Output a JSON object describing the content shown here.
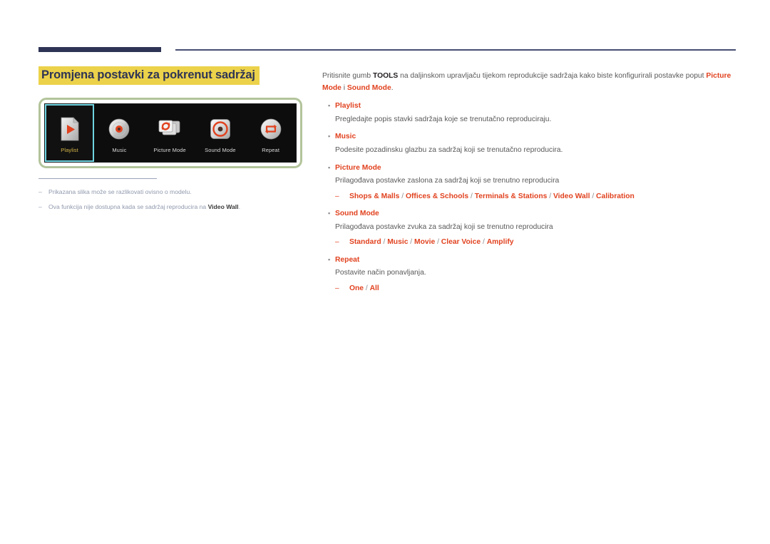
{
  "page": {
    "title": "Promjena postavki za pokrenut sadržaj",
    "accent_color": "#e1421f",
    "title_highlight_color": "#ecd24a",
    "title_text_color": "#2e3455",
    "rule_color": "#2e3455"
  },
  "device": {
    "toolbar": [
      {
        "label": "Playlist",
        "icon": "playlist-page-play-icon",
        "selected": true
      },
      {
        "label": "Music",
        "icon": "music-disc-icon",
        "selected": false
      },
      {
        "label": "Picture Mode",
        "icon": "picture-mode-cards-refresh-icon",
        "selected": false
      },
      {
        "label": "Sound Mode",
        "icon": "sound-mode-dial-icon",
        "selected": false
      },
      {
        "label": "Repeat",
        "icon": "repeat-loop-icon",
        "selected": false
      }
    ]
  },
  "footnotes": {
    "dash": "–",
    "items": [
      {
        "text_before": "Prikazana slika može se razlikovati ovisno o modelu.",
        "bold": "",
        "text_after": ""
      },
      {
        "text_before": "Ova funkcija nije dostupna kada se sadržaj reproducira na ",
        "bold": "Video Wall",
        "text_after": "."
      }
    ]
  },
  "content": {
    "intro": {
      "part1": "Pritisnite gumb ",
      "tools": "TOOLS",
      "part2": " na daljinskom upravljaču tijekom reprodukcije sadržaja kako biste konfigurirali postavke poput ",
      "picture_mode": "Picture Mode",
      "part3": " i ",
      "sound_mode": "Sound Mode",
      "part4": "."
    },
    "bullet_mark": "▪",
    "sub_mark": "–",
    "items": [
      {
        "title": "Playlist",
        "desc": "Pregledajte popis stavki sadržaja koje se trenutačno reproduciraju.",
        "options": []
      },
      {
        "title": "Music",
        "desc": "Podesite pozadinsku glazbu za sadržaj koji se trenutačno reproducira.",
        "options": []
      },
      {
        "title": "Picture Mode",
        "desc": "Prilagođava postavke zaslona za sadržaj koji se trenutno reproducira",
        "options": [
          "Shops & Malls",
          "Offices & Schools",
          "Terminals & Stations",
          "Video Wall",
          "Calibration"
        ]
      },
      {
        "title": "Sound Mode",
        "desc": "Prilagođava postavke zvuka za sadržaj koji se trenutno reproducira",
        "options": [
          "Standard",
          "Music",
          "Movie",
          "Clear Voice",
          "Amplify"
        ]
      },
      {
        "title": "Repeat",
        "desc": "Postavite način ponavljanja.",
        "options": [
          "One",
          "All"
        ]
      }
    ]
  }
}
